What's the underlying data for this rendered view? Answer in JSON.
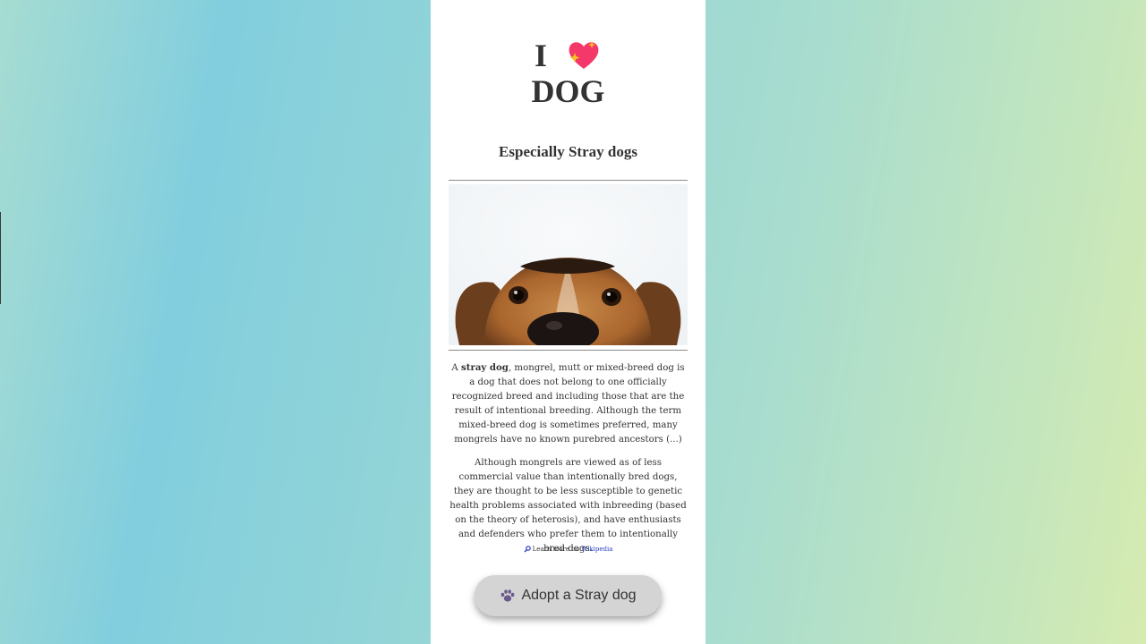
{
  "header": {
    "title_word": "I",
    "title_icon": "sparkling-heart-icon",
    "title_line2": "DOG",
    "subtitle": "Especially Stray dogs"
  },
  "image": {
    "alt": "dog peeking over edge",
    "icon": "dog-photo"
  },
  "content": {
    "p1_prefix": "A ",
    "p1_bold": "stray dog",
    "p1_rest": ", mongrel, mutt or mixed-breed dog is a dog that does not belong to one officially recognized breed and including those that are the result of intentional breeding. Although the term mixed-breed dog is sometimes preferred, many mongrels have no known purebred ancestors (...)",
    "p2": "Although mongrels are viewed as of less commercial value than intentionally bred dogs, they are thought to be less susceptible to genetic health problems associated with inbreeding (based on the theory of heterosis), and have enthusiasts and defenders who prefer them to intentionally bred dogs."
  },
  "learn_more": {
    "icon": "magnifier-icon",
    "text": "Learn more on ",
    "link": "Wikipedia"
  },
  "cta": {
    "icon": "paw-icon",
    "label": "Adopt a Stray dog"
  },
  "colors": {
    "heart": "#f4386a",
    "sparkle": "#f5c518",
    "link": "#2a3fbf",
    "button_bg": "#d4d4d4"
  }
}
